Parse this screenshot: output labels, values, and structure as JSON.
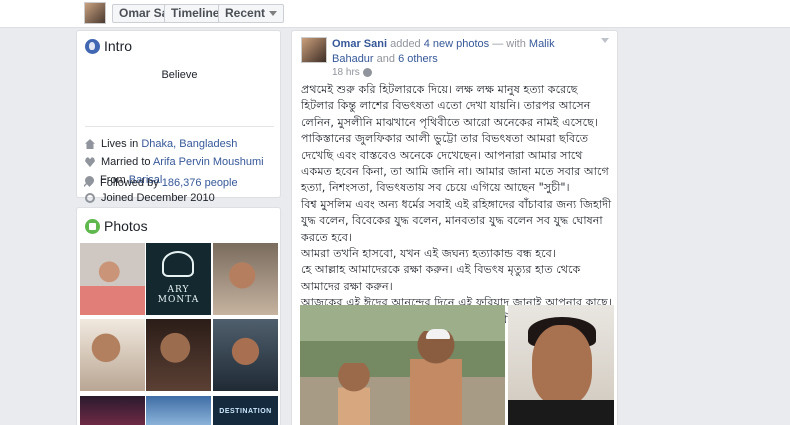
{
  "topbar": {
    "name_button": "Omar Sani",
    "timeline_button": "Timeline",
    "recent_button": "Recent"
  },
  "intro": {
    "title": "Intro",
    "bio": "Believe",
    "lives_prefix": "Lives in ",
    "lives_link": "Dhaka, Bangladesh",
    "married_prefix": "Married to ",
    "married_link": "Arifa Pervin Moushumi",
    "from_prefix": "From ",
    "from_link": "Barisal",
    "joined": "Joined December 2010",
    "followed_prefix": "Followed by ",
    "followed_link": "186,376 people"
  },
  "photos": {
    "title": "Photos",
    "thumb2_text": "ARY MONTA",
    "thumb9_text": "DESTINATION"
  },
  "post": {
    "author": "Omar Sani",
    "action": " added ",
    "photos_link": "4 new photos",
    "with_text": " — with ",
    "tag1": "Malik Bahadur",
    "and_text": " and ",
    "others": "6 others",
    "time": "18 hrs",
    "paragraphs": [
      "প্রথমেই শুরু করি হিটলারকে দিয়ে। লক্ষ লক্ষ মানুষ হত্যা করেছে হিটলার কিন্তু লাশের বিভৎষতা এতো দেখা যায়নি। তারপর আসেন লেনিন, মুসলীনি মাঝখানে পৃথিবীতে আরো অনেকের নামই এসেছে। পাকিস্তানের জুলফিকার আলী ভুট্টো তার বিভৎষতা আমরা ছবিতে দেখেছি এবং বাস্তবেও অনেকে দেখেছেন। আপনারা আমার সাথে একমত হবেন কিনা, তা আমি জানি না। আমার জানা মতে সবার আগে হত্যা, নিশংসতা, বিভৎষতায় সব চেয়ে এগিয়ে আছেন \"সুচী\"।",
      "বিশ্ব মুসলিম এবং অন্য ধর্মের সবাই এই রহিঙ্গাদের বাঁচাবার জন্য জিহাদী যুদ্ধ বলেন, বিবেকের যুদ্ধ বলেন, মানবতার যুদ্ধ বলেন সব যুদ্ধ ঘোষনা করতে হবে।",
      "আমরা তখনি হাসবো, যখন এই জঘন্য হত্যাকান্ড বন্ধ হবে।",
      "হে আল্লাহ আমাদেরকে রক্ষা করুন। এই বিভৎষ মৃত্যুর হাত থেকে আমাদের রক্ষা করুন।",
      "আজকের এই ঈদের আনন্দের দিনে এই ফরিয়াদ জানাই আপনার কাছে। ধিক্কার ধিক্কার ধিক্কার জানাই এই মানব হত্যাকারী রক্ত পিপাসু \"সুচীকে\"।।"
    ]
  }
}
